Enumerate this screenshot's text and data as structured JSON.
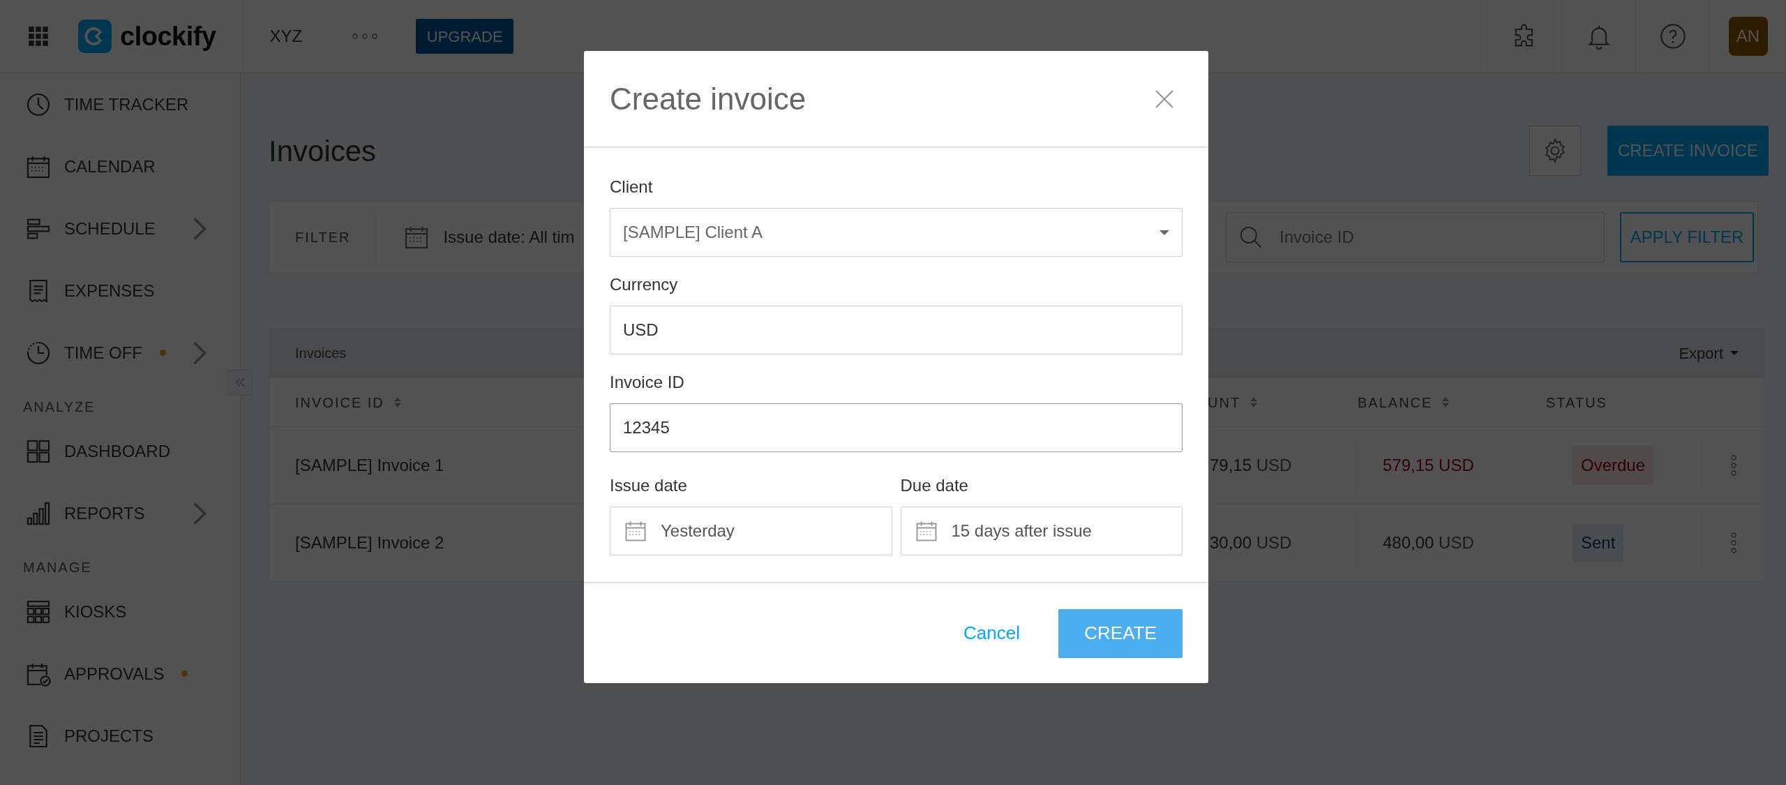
{
  "topbar": {
    "logo": "clockify",
    "workspace": "XYZ",
    "upgrade_button": "UPGRADE",
    "avatar": "AN"
  },
  "sidebar": {
    "items": [
      {
        "kind": "item",
        "label": "TIME TRACKER",
        "expandable": false,
        "notification": false
      },
      {
        "kind": "item",
        "label": "CALENDAR",
        "expandable": false,
        "notification": false
      },
      {
        "kind": "item",
        "label": "SCHEDULE",
        "expandable": true,
        "notification": false
      },
      {
        "kind": "item",
        "label": "EXPENSES",
        "expandable": false,
        "notification": false
      },
      {
        "kind": "item",
        "label": "TIME OFF",
        "expandable": true,
        "notification": true
      },
      {
        "kind": "section",
        "label": "ANALYZE"
      },
      {
        "kind": "item",
        "label": "DASHBOARD",
        "expandable": false,
        "notification": false
      },
      {
        "kind": "item",
        "label": "REPORTS",
        "expandable": true,
        "notification": false
      },
      {
        "kind": "section",
        "label": "MANAGE"
      },
      {
        "kind": "item",
        "label": "KIOSKS",
        "expandable": false,
        "notification": false
      },
      {
        "kind": "item",
        "label": "APPROVALS",
        "expandable": false,
        "notification": true
      },
      {
        "kind": "item",
        "label": "PROJECTS",
        "expandable": false,
        "notification": false
      }
    ]
  },
  "page": {
    "title": "Invoices",
    "create_button": "CREATE INVOICE"
  },
  "filter": {
    "label": "FILTER",
    "issue_date": "Issue date: All tim",
    "search_placeholder": "Invoice ID",
    "apply_button": "APPLY FILTER"
  },
  "table": {
    "caption": "Invoices",
    "export": "Export",
    "columns": [
      {
        "label": "INVOICE ID",
        "sortable": true
      },
      {
        "label": "UNT",
        "sortable": true
      },
      {
        "label": "BALANCE",
        "sortable": true
      },
      {
        "label": "STATUS",
        "sortable": false
      }
    ],
    "rows": [
      {
        "invoice_id": "[SAMPLE] Invoice 1",
        "amount": "79,15",
        "amount_currency": "USD",
        "balance": "579,15",
        "balance_currency": "USD",
        "status": {
          "label": "Overdue",
          "kind": "overdue"
        }
      },
      {
        "invoice_id": "[SAMPLE] Invoice 2",
        "amount": "30,00",
        "amount_currency": "USD",
        "balance": "480,00",
        "balance_currency": "USD",
        "status": {
          "label": "Sent",
          "kind": "sent"
        }
      }
    ]
  },
  "modal": {
    "title": "Create invoice",
    "fields": [
      {
        "kind": "select",
        "label": "Client",
        "value": "[SAMPLE] Client A",
        "focused": false
      },
      {
        "kind": "text",
        "label": "Currency",
        "value": "USD",
        "focused": false
      },
      {
        "kind": "text",
        "label": "Invoice ID",
        "value": "12345",
        "focused": true
      }
    ],
    "dates": [
      {
        "label": "Issue date",
        "value": "Yesterday"
      },
      {
        "label": "Due date",
        "value": "15 days after issue"
      }
    ],
    "cancel_button": "Cancel",
    "create_button": "CREATE"
  }
}
